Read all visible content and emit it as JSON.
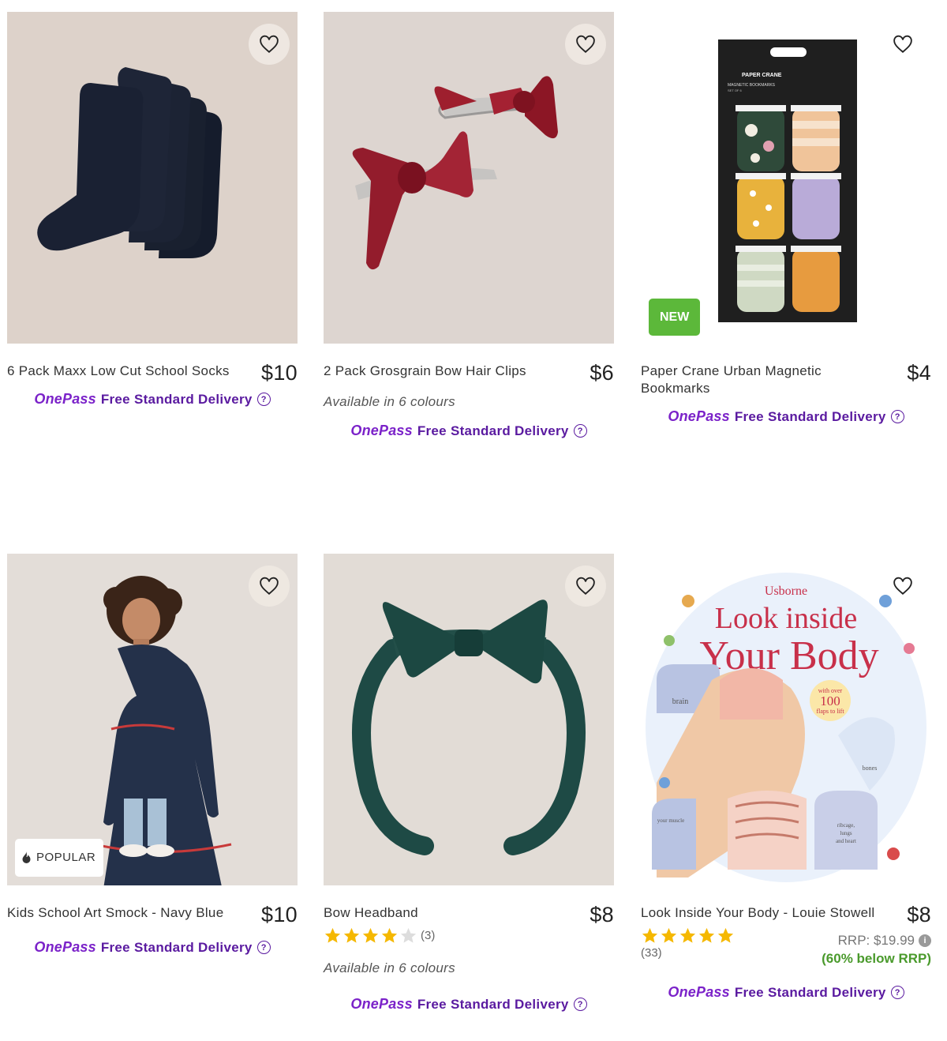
{
  "products": [
    {
      "title": "6 Pack Maxx Low Cut School Socks",
      "price": "$10"
    },
    {
      "title": "2 Pack Grosgrain Bow Hair Clips",
      "price": "$6",
      "availability": "Available in 6 colours"
    },
    {
      "title": "Paper Crane Urban Magnetic Bookmarks",
      "price": "$4",
      "badge": "NEW",
      "packaging": {
        "brand": "PAPER CRANE",
        "line": "MAGNETIC BOOKMARKS",
        "set": "SET OF 6"
      }
    },
    {
      "title": "Kids School Art Smock - Navy Blue",
      "price": "$10",
      "badge": "POPULAR"
    },
    {
      "title": "Bow Headband",
      "price": "$8",
      "rating": 4,
      "rating_count": "(3)",
      "availability": "Available in 6 colours"
    },
    {
      "title": "Look Inside Your Body - Louie Stowell",
      "price": "$8",
      "rating": 5,
      "rating_count": "(33)",
      "rrp": "RRP: $19.99",
      "saving": "(60% below RRP)",
      "cover": {
        "publisher": "Usborne",
        "line1": "Look inside",
        "line2": "Your Body",
        "flap1": "with over",
        "flap2": "100",
        "flap3": "flaps to lift",
        "label_brain": "brain",
        "label_bones": "bones",
        "label_muscle": "your muscle",
        "label_ribs1": "ribcage,",
        "label_ribs2": "lungs",
        "label_ribs3": "and heart"
      }
    }
  ],
  "delivery": {
    "brand_one": "One",
    "brand_pass": "Pass",
    "text": "Free Standard Delivery",
    "help": "?"
  },
  "icons": {
    "wishlist": "heart-outline-icon",
    "popular": "flame-icon",
    "help": "question-circle-icon",
    "info": "info-icon",
    "star": "star-icon"
  },
  "colors": {
    "onepass_purple": "#7b22c9",
    "delivery_purple": "#5a1aa0",
    "new_green": "#5cb83a",
    "saving_green": "#4a9a2c",
    "star_gold": "#f5b800"
  }
}
